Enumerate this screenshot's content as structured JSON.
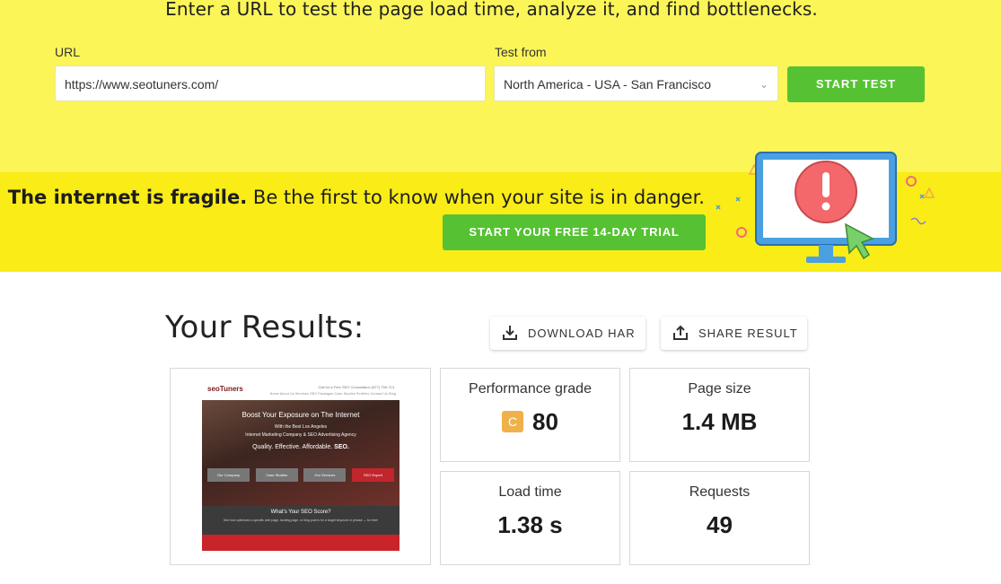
{
  "hero": {
    "headline": "Enter a URL to test the page load time, analyze it, and find bottlenecks.",
    "url_label": "URL",
    "url_value": "https://www.seotuners.com/",
    "test_from_label": "Test from",
    "test_from_value": "North America - USA - San Francisco",
    "start_button": "START TEST"
  },
  "banner": {
    "bold_text": "The internet is fragile.",
    "rest_text": " Be the first to know when your site is in danger.",
    "trial_button": "START YOUR FREE 14-DAY TRIAL"
  },
  "results": {
    "title": "Your Results:",
    "download_button": "DOWNLOAD HAR",
    "share_button": "SHARE RESULT",
    "performance_label": "Performance grade",
    "grade_letter": "C",
    "performance_value": "80",
    "page_size_label": "Page size",
    "page_size_value": "1.4 MB",
    "load_time_label": "Load time",
    "load_time_value": "1.38 s",
    "requests_label": "Requests",
    "requests_value": "49"
  },
  "screenshot": {
    "logo": "seoTuners",
    "call": "Call for a Free SEO Consultation (877) 756-713",
    "nav": "Home About Us Services SEO Packages Case Studies Portfolio Contact Us Blog",
    "headline": "Boost Your Exposure on The Internet",
    "sub1": "With the Best Los Angeles",
    "sub2": "Internet Marketing Company & SEO Advertising Agency",
    "tagline_1": "Quality. Effective. Affordable.",
    "tagline_2": "SEO.",
    "btn1": "Our Company",
    "btn2": "Case Studies",
    "btn3": "Our Services",
    "btn4": "SEO Expert",
    "score_title": "What's Your SEO Score?",
    "score_desc": "See how optimized a specific web page, landing page, or blog post is for a target keyword or phrase — for free!"
  },
  "colors": {
    "hero_bg": "#fbf558",
    "banner_bg": "#f9ec17",
    "accent_green": "#56c233",
    "grade_c": "#f0b14a"
  },
  "icons": {
    "download": "download-icon",
    "share": "share-icon",
    "chevron": "chevron-down-icon",
    "alert_monitor": "alert-monitor-illustration"
  }
}
